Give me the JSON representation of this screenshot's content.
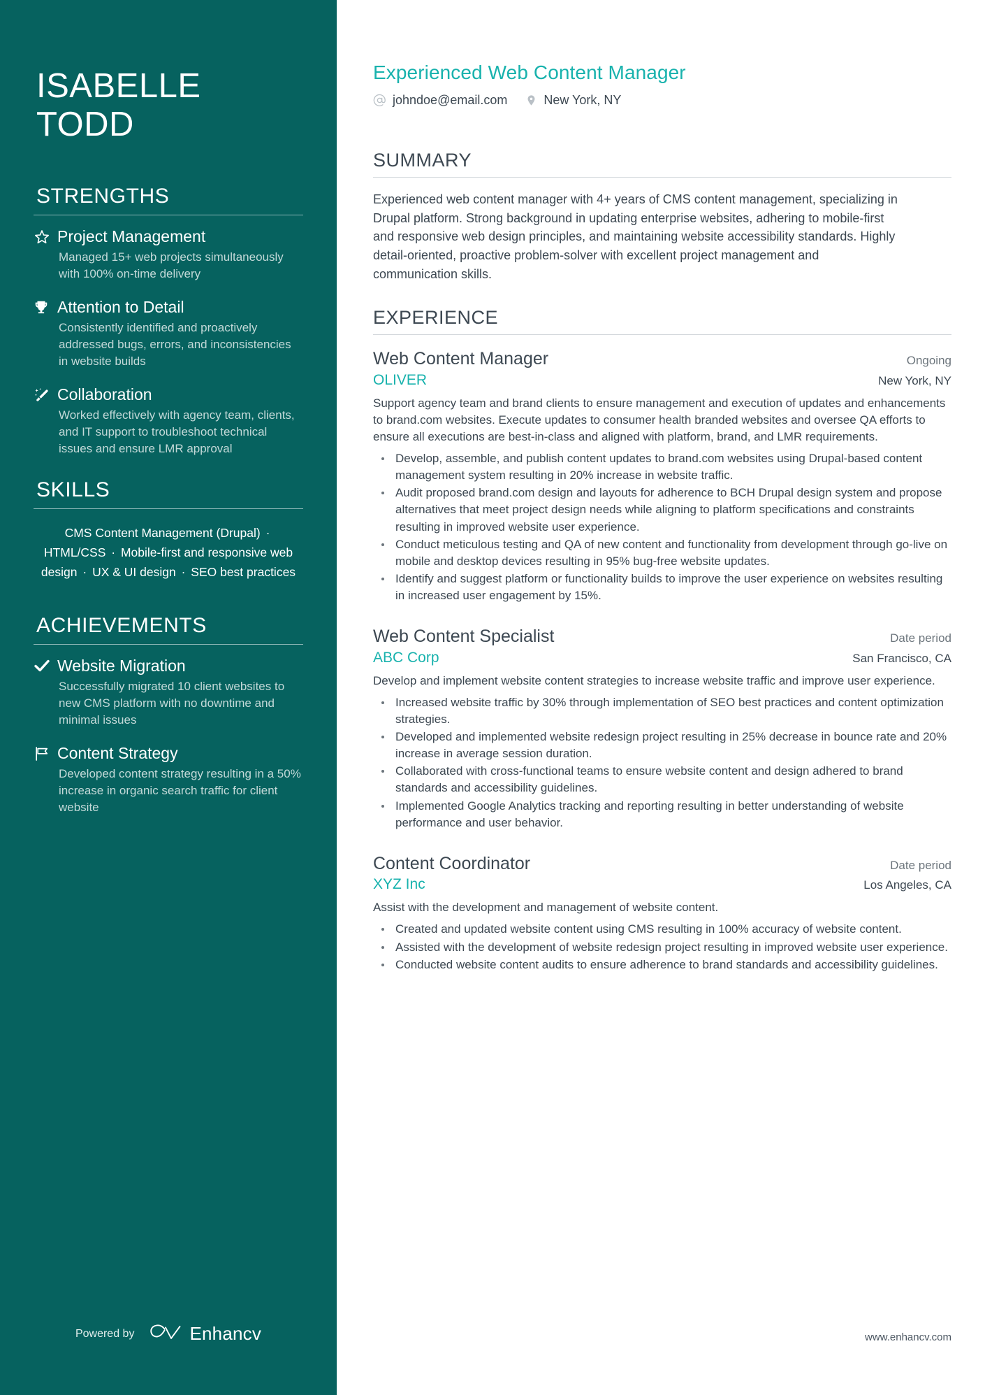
{
  "sidebar": {
    "name": "ISABELLE TODD",
    "strengths": {
      "title": "STRENGTHS",
      "items": [
        {
          "icon": "star-icon",
          "title": "Project Management",
          "desc": "Managed 15+ web projects simultaneously with 100% on-time delivery"
        },
        {
          "icon": "trophy-icon",
          "title": "Attention to Detail",
          "desc": "Consistently identified and proactively addressed bugs, errors, and inconsistencies in website builds"
        },
        {
          "icon": "magic-wand-icon",
          "title": "Collaboration",
          "desc": "Worked effectively with agency team, clients, and IT support to troubleshoot technical issues and ensure LMR approval"
        }
      ]
    },
    "skills": {
      "title": "SKILLS",
      "separator": "·",
      "items": [
        "CMS Content Management (Drupal)",
        "HTML/CSS",
        "Mobile-first and responsive web design",
        "UX & UI design",
        "SEO best practices"
      ]
    },
    "achievements": {
      "title": "ACHIEVEMENTS",
      "items": [
        {
          "icon": "check-icon",
          "title": "Website Migration",
          "desc": "Successfully migrated 10 client websites to new CMS platform with no downtime and minimal issues"
        },
        {
          "icon": "flag-icon",
          "title": "Content Strategy",
          "desc": "Developed content strategy resulting in a 50% increase in organic search traffic for client website"
        }
      ]
    },
    "footer": {
      "powered_by": "Powered by",
      "brand": "Enhancv",
      "logo_icon": "enhancv-infinity-icon"
    }
  },
  "main": {
    "headline": "Experienced Web Content Manager",
    "contacts": [
      {
        "icon": "at-icon",
        "value": "johndoe@email.com"
      },
      {
        "icon": "map-pin-icon",
        "value": "New York, NY"
      }
    ],
    "summary": {
      "title": "SUMMARY",
      "text": "Experienced web content manager with 4+ years of CMS content management, specializing in Drupal platform. Strong background in updating enterprise websites, adhering to mobile-first and responsive web design principles, and maintaining website accessibility standards. Highly detail-oriented, proactive problem-solver with excellent project management and communication skills."
    },
    "experience": {
      "title": "EXPERIENCE",
      "jobs": [
        {
          "title": "Web Content Manager",
          "date": "Ongoing",
          "company": "OLIVER",
          "location": "New York, NY",
          "desc": "Support agency team and brand clients to ensure management and execution of updates and enhancements to brand.com websites. Execute updates to consumer health branded websites and oversee QA efforts to ensure all executions are best-in-class and aligned with platform, brand, and LMR requirements.",
          "bullets": [
            "Develop, assemble, and publish content updates to brand.com websites using Drupal-based content management system resulting in 20% increase in website traffic.",
            "Audit proposed brand.com design and layouts for adherence to BCH Drupal design system and propose alternatives that meet project design needs while aligning to platform specifications and constraints resulting in improved website user experience.",
            "Conduct meticulous testing and QA of new content and functionality from development through go-live on mobile and desktop devices resulting in 95% bug-free website updates.",
            "Identify and suggest platform or functionality builds to improve the user experience on websites resulting in increased user engagement by 15%."
          ]
        },
        {
          "title": "Web Content Specialist",
          "date": "Date period",
          "company": "ABC Corp",
          "location": "San Francisco, CA",
          "desc": "Develop and implement website content strategies to increase website traffic and improve user experience.",
          "bullets": [
            "Increased website traffic by 30% through implementation of SEO best practices and content optimization strategies.",
            "Developed and implemented website redesign project resulting in 25% decrease in bounce rate and 20% increase in average session duration.",
            "Collaborated with cross-functional teams to ensure website content and design adhered to brand standards and accessibility guidelines.",
            "Implemented Google Analytics tracking and reporting resulting in better understanding of website performance and user behavior."
          ]
        },
        {
          "title": "Content Coordinator",
          "date": "Date period",
          "company": "XYZ Inc",
          "location": "Los Angeles, CA",
          "desc": "Assist with the development and management of website content.",
          "bullets": [
            "Created and updated website content using CMS resulting in 100% accuracy of website content.",
            "Assisted with the development of website redesign project resulting in improved website user experience.",
            "Conducted website content audits to ensure adherence to brand standards and accessibility guidelines."
          ]
        }
      ]
    },
    "footer": {
      "website": "www.enhancv.com"
    }
  },
  "colors": {
    "sidebar_bg": "#06625f",
    "accent": "#18b2ad",
    "body_text": "#3d4852",
    "muted_text": "#6c757c",
    "sidebar_desc": "#c3d9d8"
  }
}
